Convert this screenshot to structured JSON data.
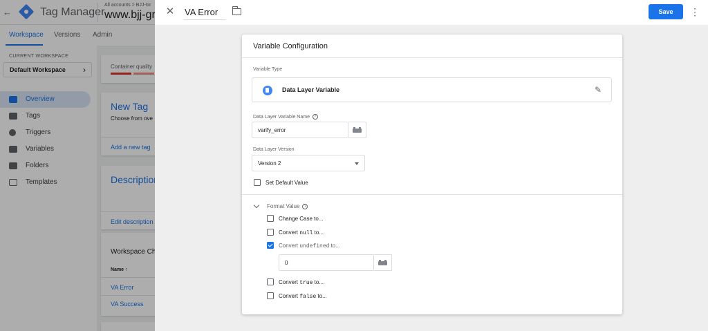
{
  "app": {
    "title": "Tag Manager",
    "breadcrumb": "All accounts > BJJ-Gr",
    "container_name": "www.bjj-gra",
    "back_icon": "back-arrow-icon"
  },
  "tabs": [
    {
      "label": "Workspace",
      "active": true
    },
    {
      "label": "Versions",
      "active": false
    },
    {
      "label": "Admin",
      "active": false
    }
  ],
  "workspace": {
    "caption": "CURRENT WORKSPACE",
    "name": "Default Workspace"
  },
  "nav": [
    {
      "label": "Overview",
      "active": true,
      "icon": "briefcase-icon"
    },
    {
      "label": "Tags",
      "active": false,
      "icon": "tag-icon"
    },
    {
      "label": "Triggers",
      "active": false,
      "icon": "trigger-icon"
    },
    {
      "label": "Variables",
      "active": false,
      "icon": "variables-icon"
    },
    {
      "label": "Folders",
      "active": false,
      "icon": "folder-icon"
    },
    {
      "label": "Templates",
      "active": false,
      "icon": "templates-icon"
    }
  ],
  "overview": {
    "container_quality": "Container quality",
    "new_tag_title": "New Tag",
    "new_tag_sub": "Choose from ove",
    "add_new_tag": "Add a new tag",
    "description_title": "Description",
    "edit_description": "Edit description",
    "workspace_changes": "Workspace Ch",
    "name_column": "Name ↑",
    "rows": [
      "VA Error",
      "VA Success"
    ]
  },
  "editor": {
    "variable_name": "VA Error",
    "save_label": "Save",
    "config_title": "Variable Configuration",
    "variable_type_label": "Variable Type",
    "variable_type_name": "Data Layer Variable",
    "dl_name_label": "Data Layer Variable Name",
    "dl_name_value": "varify_error",
    "dl_version_label": "Data Layer Version",
    "dl_version_value": "Version 2",
    "set_default_label": "Set Default Value",
    "set_default_checked": false,
    "format_value_label": "Format Value",
    "format_options": [
      {
        "prefix": "Change Case to...",
        "code": "",
        "suffix": "",
        "checked": false
      },
      {
        "prefix": "Convert ",
        "code": "null",
        "suffix": " to...",
        "checked": false
      },
      {
        "prefix": "Convert ",
        "code": "undefined",
        "suffix": " to...",
        "checked": true
      },
      {
        "prefix": "Convert ",
        "code": "true",
        "suffix": " to...",
        "checked": false
      },
      {
        "prefix": "Convert ",
        "code": "false",
        "suffix": " to...",
        "checked": false
      }
    ],
    "undefined_value": "0"
  },
  "colors": {
    "accent": "#1a73e8",
    "scrim": "rgba(0,0,0,0.32)"
  }
}
